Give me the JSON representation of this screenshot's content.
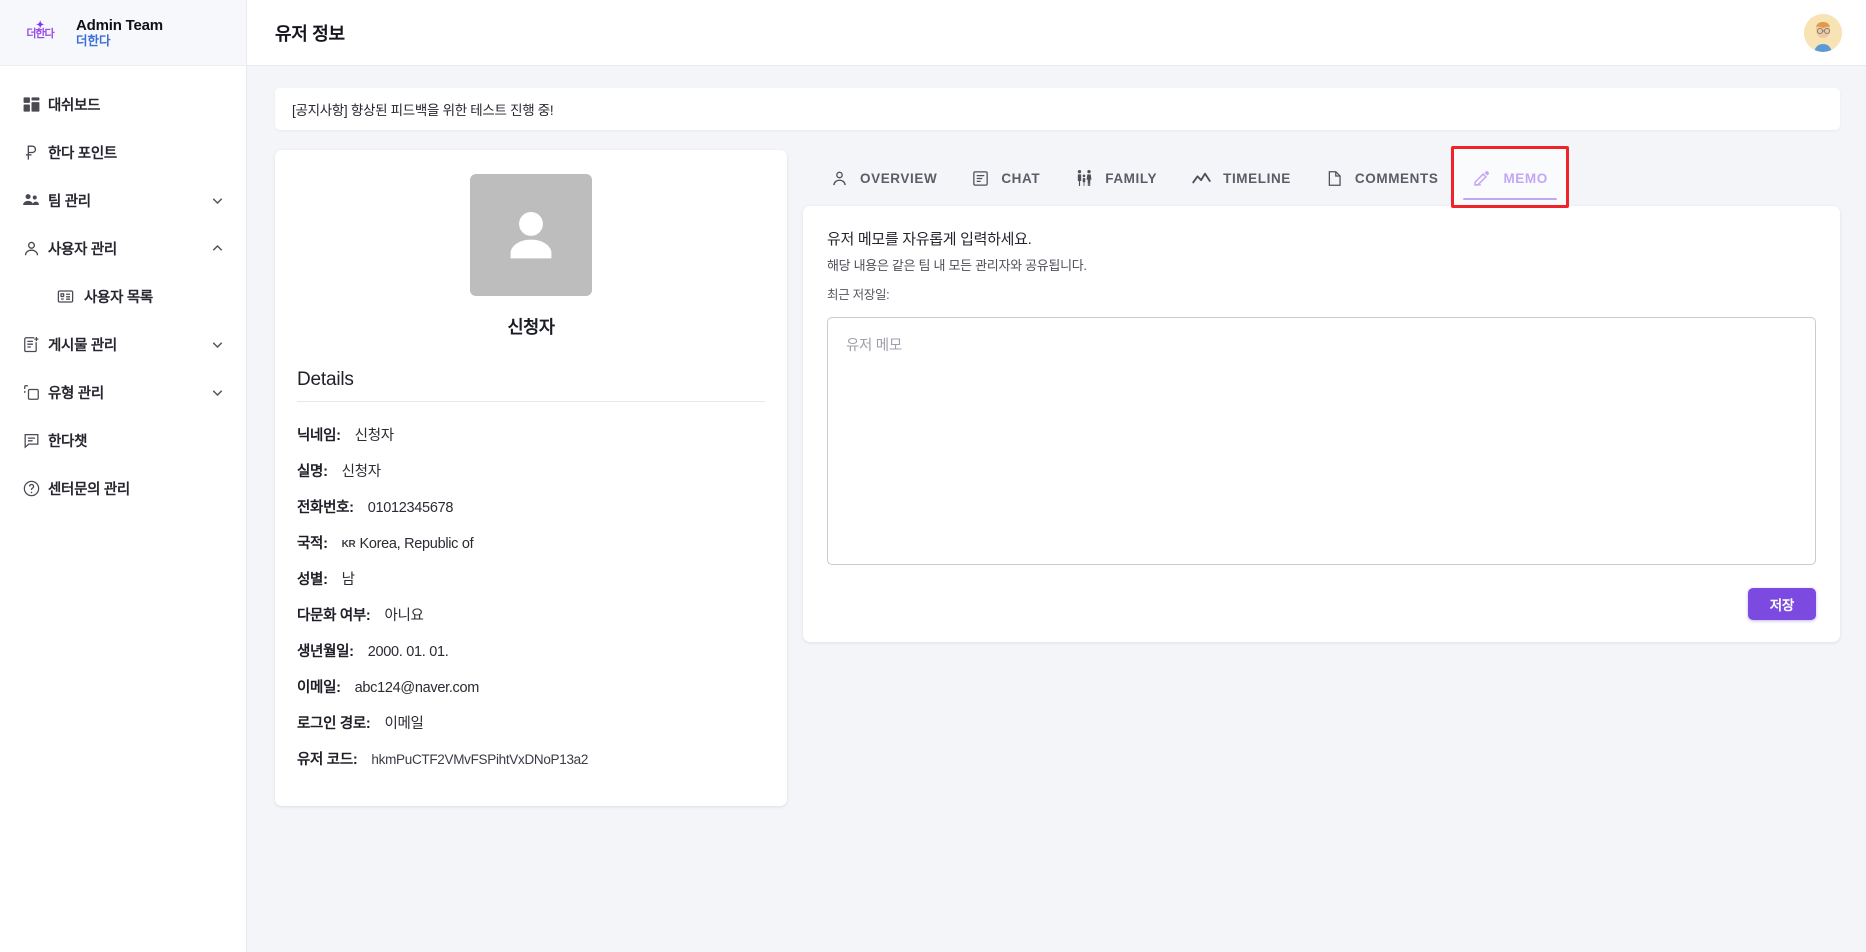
{
  "brand": {
    "logo_icon": "handa-logo-icon",
    "logo_text": "더한다",
    "title": "Admin Team",
    "subtitle": "더한다"
  },
  "sidebar": {
    "items": [
      {
        "icon": "dashboard-icon",
        "label": "대쉬보드",
        "chevron": "",
        "sub": false
      },
      {
        "icon": "point-icon",
        "label": "한다 포인트",
        "chevron": "",
        "sub": false
      },
      {
        "icon": "team-icon",
        "label": "팀 관리",
        "chevron": "chevron-down-icon",
        "sub": false
      },
      {
        "icon": "user-icon",
        "label": "사용자 관리",
        "chevron": "chevron-up-icon",
        "sub": false
      },
      {
        "icon": "list-card-icon",
        "label": "사용자 목록",
        "chevron": "",
        "sub": true
      },
      {
        "icon": "post-add-icon",
        "label": "게시물 관리",
        "chevron": "chevron-down-icon",
        "sub": false
      },
      {
        "icon": "copy-icon",
        "label": "유형 관리",
        "chevron": "chevron-down-icon",
        "sub": false
      },
      {
        "icon": "chat-icon",
        "label": "한다챗",
        "chevron": "",
        "sub": false
      },
      {
        "icon": "help-circle-icon",
        "label": "센터문의 관리",
        "chevron": "",
        "sub": false
      }
    ]
  },
  "topbar": {
    "page_title": "유저 정보",
    "avatar_icon": "user-avatar"
  },
  "notice": {
    "text": "[공지사항] 향상된 피드백을 위한 테스트 진행 중!"
  },
  "profile": {
    "avatar_icon": "person-placeholder-icon",
    "name": "신청자",
    "details_title": "Details",
    "rows": [
      {
        "key": "닉네임:",
        "value": "신청자",
        "flag": ""
      },
      {
        "key": "실명:",
        "value": "신청자",
        "flag": ""
      },
      {
        "key": "전화번호:",
        "value": "01012345678",
        "flag": ""
      },
      {
        "key": "국적:",
        "value": "Korea, Republic of",
        "flag": "KR"
      },
      {
        "key": "성별:",
        "value": "남",
        "flag": ""
      },
      {
        "key": "다문화 여부:",
        "value": "아니요",
        "flag": ""
      },
      {
        "key": "생년월일:",
        "value": "2000. 01. 01.",
        "flag": ""
      },
      {
        "key": "이메일:",
        "value": "abc124@naver.com",
        "flag": ""
      },
      {
        "key": "로그인 경로:",
        "value": "이메일",
        "flag": ""
      },
      {
        "key": "유저 코드:",
        "value": "hkmPuCTF2VMvFSPihtVxDNoP13a2",
        "flag": ""
      }
    ]
  },
  "tabs": [
    {
      "icon": "person-outline-icon",
      "label": "OVERVIEW",
      "active": false
    },
    {
      "icon": "chat-bubble-icon",
      "label": "CHAT",
      "active": false
    },
    {
      "icon": "family-icon",
      "label": "FAMILY",
      "active": false
    },
    {
      "icon": "trending-line-icon",
      "label": "TIMELINE",
      "active": false
    },
    {
      "icon": "document-icon",
      "label": "COMMENTS",
      "active": false
    },
    {
      "icon": "pencil-edit-icon",
      "label": "MEMO",
      "active": true
    }
  ],
  "memo": {
    "heading": "유저 메모를 자유롭게 입력하세요.",
    "subheading": "해당 내용은 같은 팀 내 모든 관리자와 공유됩니다.",
    "saved_label": "최근 저장일:",
    "textarea_value": "",
    "textarea_placeholder": "유저 메모",
    "save_label": "저장"
  },
  "colors": {
    "accent": "#7c3aed",
    "save_button": "#7c4ae0",
    "highlight_box": "#f0222a",
    "page_bg": "#f4f5f9"
  }
}
